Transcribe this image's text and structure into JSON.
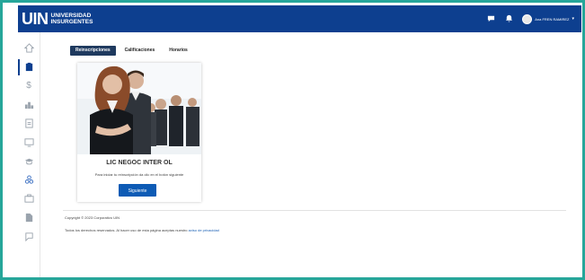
{
  "header": {
    "logo_mark": "UIN",
    "logo_line1": "UNIVERSIDAD",
    "logo_line2": "INSURGENTES",
    "chat_icon": "chat-icon",
    "bell_icon": "bell-icon",
    "user_name": "Ana FREN RAMIREZ",
    "bg_color": "#0d3f8f"
  },
  "sidebar": {
    "items": [
      {
        "icon": "home-icon",
        "glyph": "⌂",
        "active": false
      },
      {
        "icon": "clipboard-icon",
        "glyph": "▣",
        "active": true
      },
      {
        "icon": "dollar-icon",
        "glyph": "$",
        "active": false
      },
      {
        "icon": "podium-icon",
        "glyph": "▟",
        "active": false
      },
      {
        "icon": "document-icon",
        "glyph": "▤",
        "active": false
      },
      {
        "icon": "screen-icon",
        "glyph": "▭",
        "active": false
      },
      {
        "icon": "graduation-cap-icon",
        "glyph": "≘",
        "active": false
      },
      {
        "icon": "people-icon",
        "glyph": "☺",
        "active": false
      },
      {
        "icon": "briefcase-icon",
        "glyph": "▦",
        "active": false
      },
      {
        "icon": "file-icon",
        "glyph": "▥",
        "active": false
      },
      {
        "icon": "chat-bubble-icon",
        "glyph": "◻",
        "active": false
      }
    ]
  },
  "tabs": [
    {
      "label": "Reinscripciones",
      "active": true
    },
    {
      "label": "Calificaciones",
      "active": false
    },
    {
      "label": "Horarios",
      "active": false
    }
  ],
  "card": {
    "title": "LIC NEGOC INTER OL",
    "description": "Para iniciar tu reinscripción da clic en el botón siguiente",
    "button_label": "Siguiente"
  },
  "footer": {
    "copyright": "Copyright © 2023 Corporativo UIN",
    "text": "Todos los derechos reservados. Al hacer uso de esta página aceptas nuestro",
    "link": "aviso de privacidad"
  }
}
